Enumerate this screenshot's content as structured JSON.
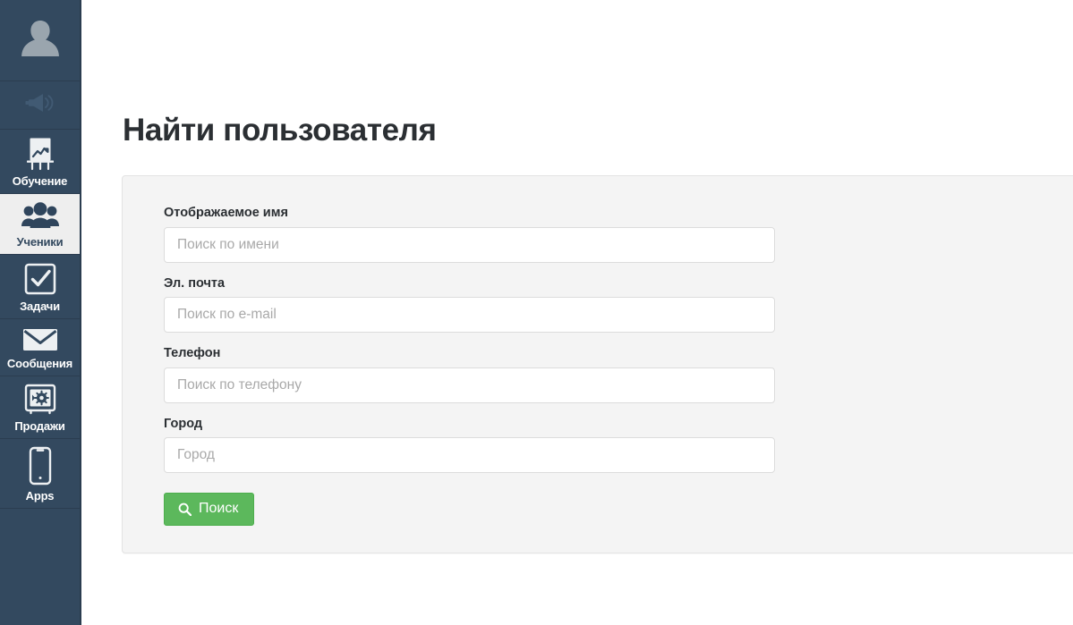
{
  "sidebar": {
    "avatar": {
      "name": "user-avatar-placeholder"
    },
    "items": [
      {
        "label": "",
        "icon": "megaphone-icon",
        "active": false,
        "muted": true
      },
      {
        "label": "Обучение",
        "icon": "easel-chart-icon",
        "active": false
      },
      {
        "label": "Ученики",
        "icon": "users-group-icon",
        "active": true
      },
      {
        "label": "Задачи",
        "icon": "checkbox-check-icon",
        "active": false
      },
      {
        "label": "Сообщения",
        "icon": "envelope-icon",
        "active": false
      },
      {
        "label": "Продажи",
        "icon": "safe-vault-icon",
        "active": false
      },
      {
        "label": "Apps",
        "icon": "smartphone-icon",
        "active": false
      }
    ]
  },
  "main": {
    "title": "Найти пользователя",
    "fields": [
      {
        "label": "Отображаемое имя",
        "placeholder": "Поиск по имени",
        "value": ""
      },
      {
        "label": "Эл. почта",
        "placeholder": "Поиск по e-mail",
        "value": ""
      },
      {
        "label": "Телефон",
        "placeholder": "Поиск по телефону",
        "value": ""
      },
      {
        "label": "Город",
        "placeholder": "Город",
        "value": ""
      }
    ],
    "submit": {
      "label": "Поиск",
      "icon": "search-magnifier-icon"
    }
  },
  "colors": {
    "sidebar_bg": "#33495f",
    "sidebar_divider": "#2b3d50",
    "sidebar_active_bg": "#eeeeee",
    "card_bg": "#f4f4f4",
    "card_border": "#e3e3e3",
    "accent_green": "#5cb85c",
    "title_text": "#2b2f33",
    "placeholder_text": "#a9a9a9"
  }
}
